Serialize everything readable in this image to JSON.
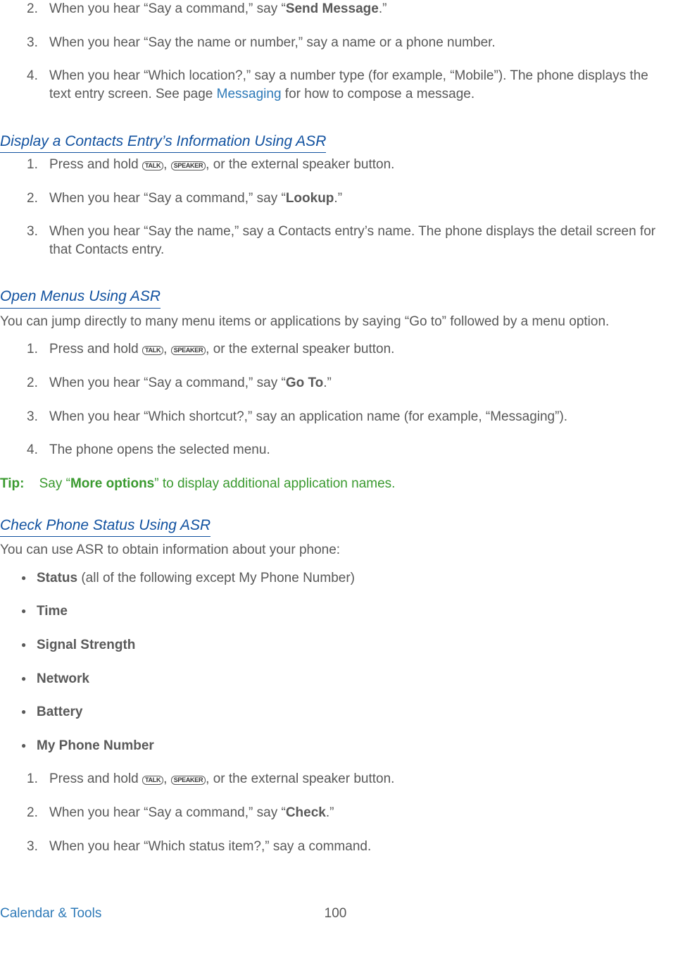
{
  "icons": {
    "talk": "TALK",
    "speaker": "SPEAKER"
  },
  "section_a": {
    "items": [
      {
        "num": "2.",
        "pre": "When you hear “Say a command,” say “",
        "bold": "Send Message",
        "post": ".”"
      },
      {
        "num": "3.",
        "text": "When you hear “Say the name or number,” say a name or a phone number."
      },
      {
        "num": "4.",
        "pre": "When you hear “Which location?,” say a number type (for example, “Mobile”). The phone displays the text entry screen. See page ",
        "link": "Messaging",
        "post": " for how to compose a message."
      }
    ]
  },
  "section_b": {
    "heading": "Display a Contacts Entry’s Information Using ASR",
    "items": [
      {
        "num": "1.",
        "pre": "Press and hold ",
        "mid": ", ",
        "post": ", or the external speaker button."
      },
      {
        "num": "2.",
        "pre": "When you hear “Say a command,” say “",
        "bold": "Lookup",
        "post": ".”"
      },
      {
        "num": "3.",
        "text": "When you hear “Say the name,” say a Contacts entry’s name. The phone displays the detail screen for that Contacts entry."
      }
    ]
  },
  "section_c": {
    "heading": "Open Menus Using ASR",
    "intro": "You can jump directly to many menu items or applications by saying “Go to” followed by a menu option.",
    "items": [
      {
        "num": "1.",
        "pre": "Press and hold ",
        "mid": ", ",
        "post": ", or the external speaker button."
      },
      {
        "num": "2.",
        "pre": "When you hear “Say a command,” say “",
        "bold": "Go To",
        "post": ".”"
      },
      {
        "num": "3.",
        "text": "When you hear “Which shortcut?,” say an application name (for example, “Messaging”)."
      },
      {
        "num": "4.",
        "text": "The phone opens the selected menu."
      }
    ]
  },
  "tip": {
    "label": "Tip:",
    "pre": "Say “",
    "bold": "More options",
    "post": "” to display additional application names."
  },
  "section_d": {
    "heading": "Check Phone Status Using ASR",
    "intro": "You can use ASR to obtain information about your phone:",
    "bullets": [
      {
        "bold": "Status",
        "rest": " (all of the following except My Phone Number)"
      },
      {
        "bold": "Time",
        "rest": ""
      },
      {
        "bold": "Signal Strength",
        "rest": ""
      },
      {
        "bold": "Network",
        "rest": ""
      },
      {
        "bold": "Battery",
        "rest": ""
      },
      {
        "bold": "My Phone Number",
        "rest": ""
      }
    ],
    "items": [
      {
        "num": "1.",
        "pre": "Press and hold ",
        "mid": ", ",
        "post": ", or the external speaker button."
      },
      {
        "num": "2.",
        "pre": "When you hear “Say a command,” say “",
        "bold": "Check",
        "post": ".”"
      },
      {
        "num": "3.",
        "text": "When you hear “Which status item?,” say a command."
      }
    ]
  },
  "footer": {
    "left": "Calendar & Tools",
    "page": "100"
  }
}
